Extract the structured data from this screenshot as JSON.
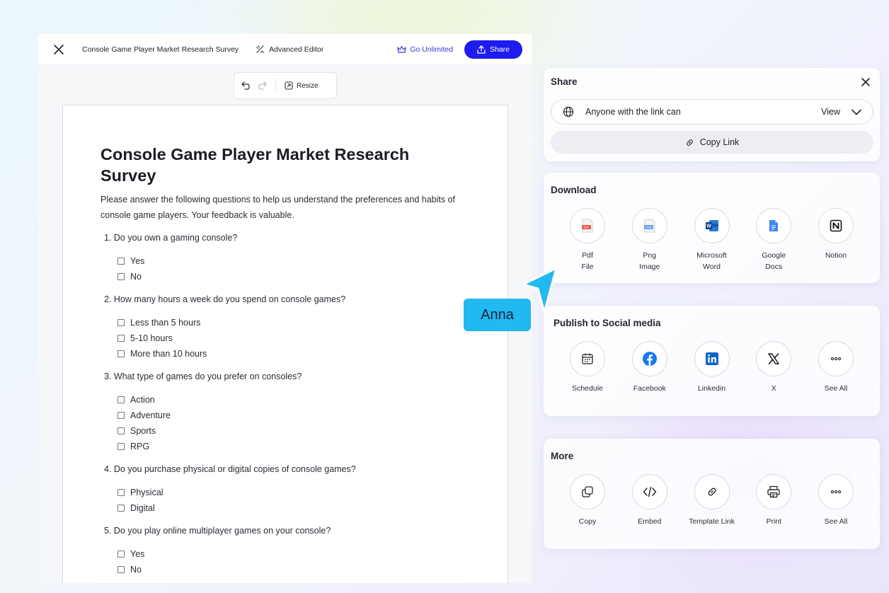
{
  "editor": {
    "doc_title": "Console Game Player Market Research Survey",
    "advanced_editor": "Advanced Editor",
    "go_unlimited": "Go Unlimited",
    "share": "Share",
    "toolbar": {
      "resize": "Resize"
    }
  },
  "document": {
    "title": "Console Game Player Market Research Survey",
    "intro": "Please answer the following questions to help us understand the preferences and habits of console game players. Your feedback is valuable.",
    "questions": [
      {
        "text": "1. Do you own a gaming console?",
        "options": [
          "Yes",
          "No"
        ]
      },
      {
        "text": "2. How many hours a week do you spend on console games?",
        "options": [
          "Less than 5 hours",
          "5-10 hours",
          "More than 10 hours"
        ]
      },
      {
        "text": "3. What type of games do you prefer on consoles?",
        "options": [
          "Action",
          "Adventure",
          "Sports",
          "RPG"
        ]
      },
      {
        "text": "4. Do you purchase physical or digital copies of console games?",
        "options": [
          "Physical",
          "Digital"
        ]
      },
      {
        "text": "5. Do you play online multiplayer games on your console?",
        "options": [
          "Yes",
          "No"
        ]
      }
    ]
  },
  "share_panel": {
    "title": "Share",
    "access_text": "Anyone with the link can",
    "access_value": "View",
    "copy_link": "Copy Link"
  },
  "download_panel": {
    "title": "Download",
    "items": [
      {
        "line1": "Pdf",
        "line2": "File",
        "icon": "pdf-icon"
      },
      {
        "line1": "Png",
        "line2": "Image",
        "icon": "png-icon"
      },
      {
        "line1": "Microsoft",
        "line2": "Word",
        "icon": "word-icon"
      },
      {
        "line1": "Google",
        "line2": "Docs",
        "icon": "google-docs-icon"
      },
      {
        "line1": "Notion",
        "line2": "",
        "icon": "notion-icon"
      }
    ]
  },
  "social_panel": {
    "title": "Publish to Social media",
    "items": [
      {
        "label": "Schedule",
        "icon": "calendar-icon"
      },
      {
        "label": "Facebook",
        "icon": "facebook-icon"
      },
      {
        "label": "Linkedin",
        "icon": "linkedin-icon"
      },
      {
        "label": "X",
        "icon": "x-icon"
      },
      {
        "label": "See All",
        "icon": "more-icon"
      }
    ]
  },
  "more_panel": {
    "title": "More",
    "items": [
      {
        "label": "Copy",
        "icon": "copy-icon"
      },
      {
        "label": "Embed",
        "icon": "code-icon"
      },
      {
        "label": "Template Link",
        "icon": "link-icon"
      },
      {
        "label": "Print",
        "icon": "printer-icon"
      },
      {
        "label": "See All",
        "icon": "more-icon"
      }
    ]
  },
  "collaborator": {
    "name": "Anna",
    "color": "#22b8f0"
  },
  "colors": {
    "accent": "#1f1cf0",
    "brand_link": "#3a36d8"
  }
}
